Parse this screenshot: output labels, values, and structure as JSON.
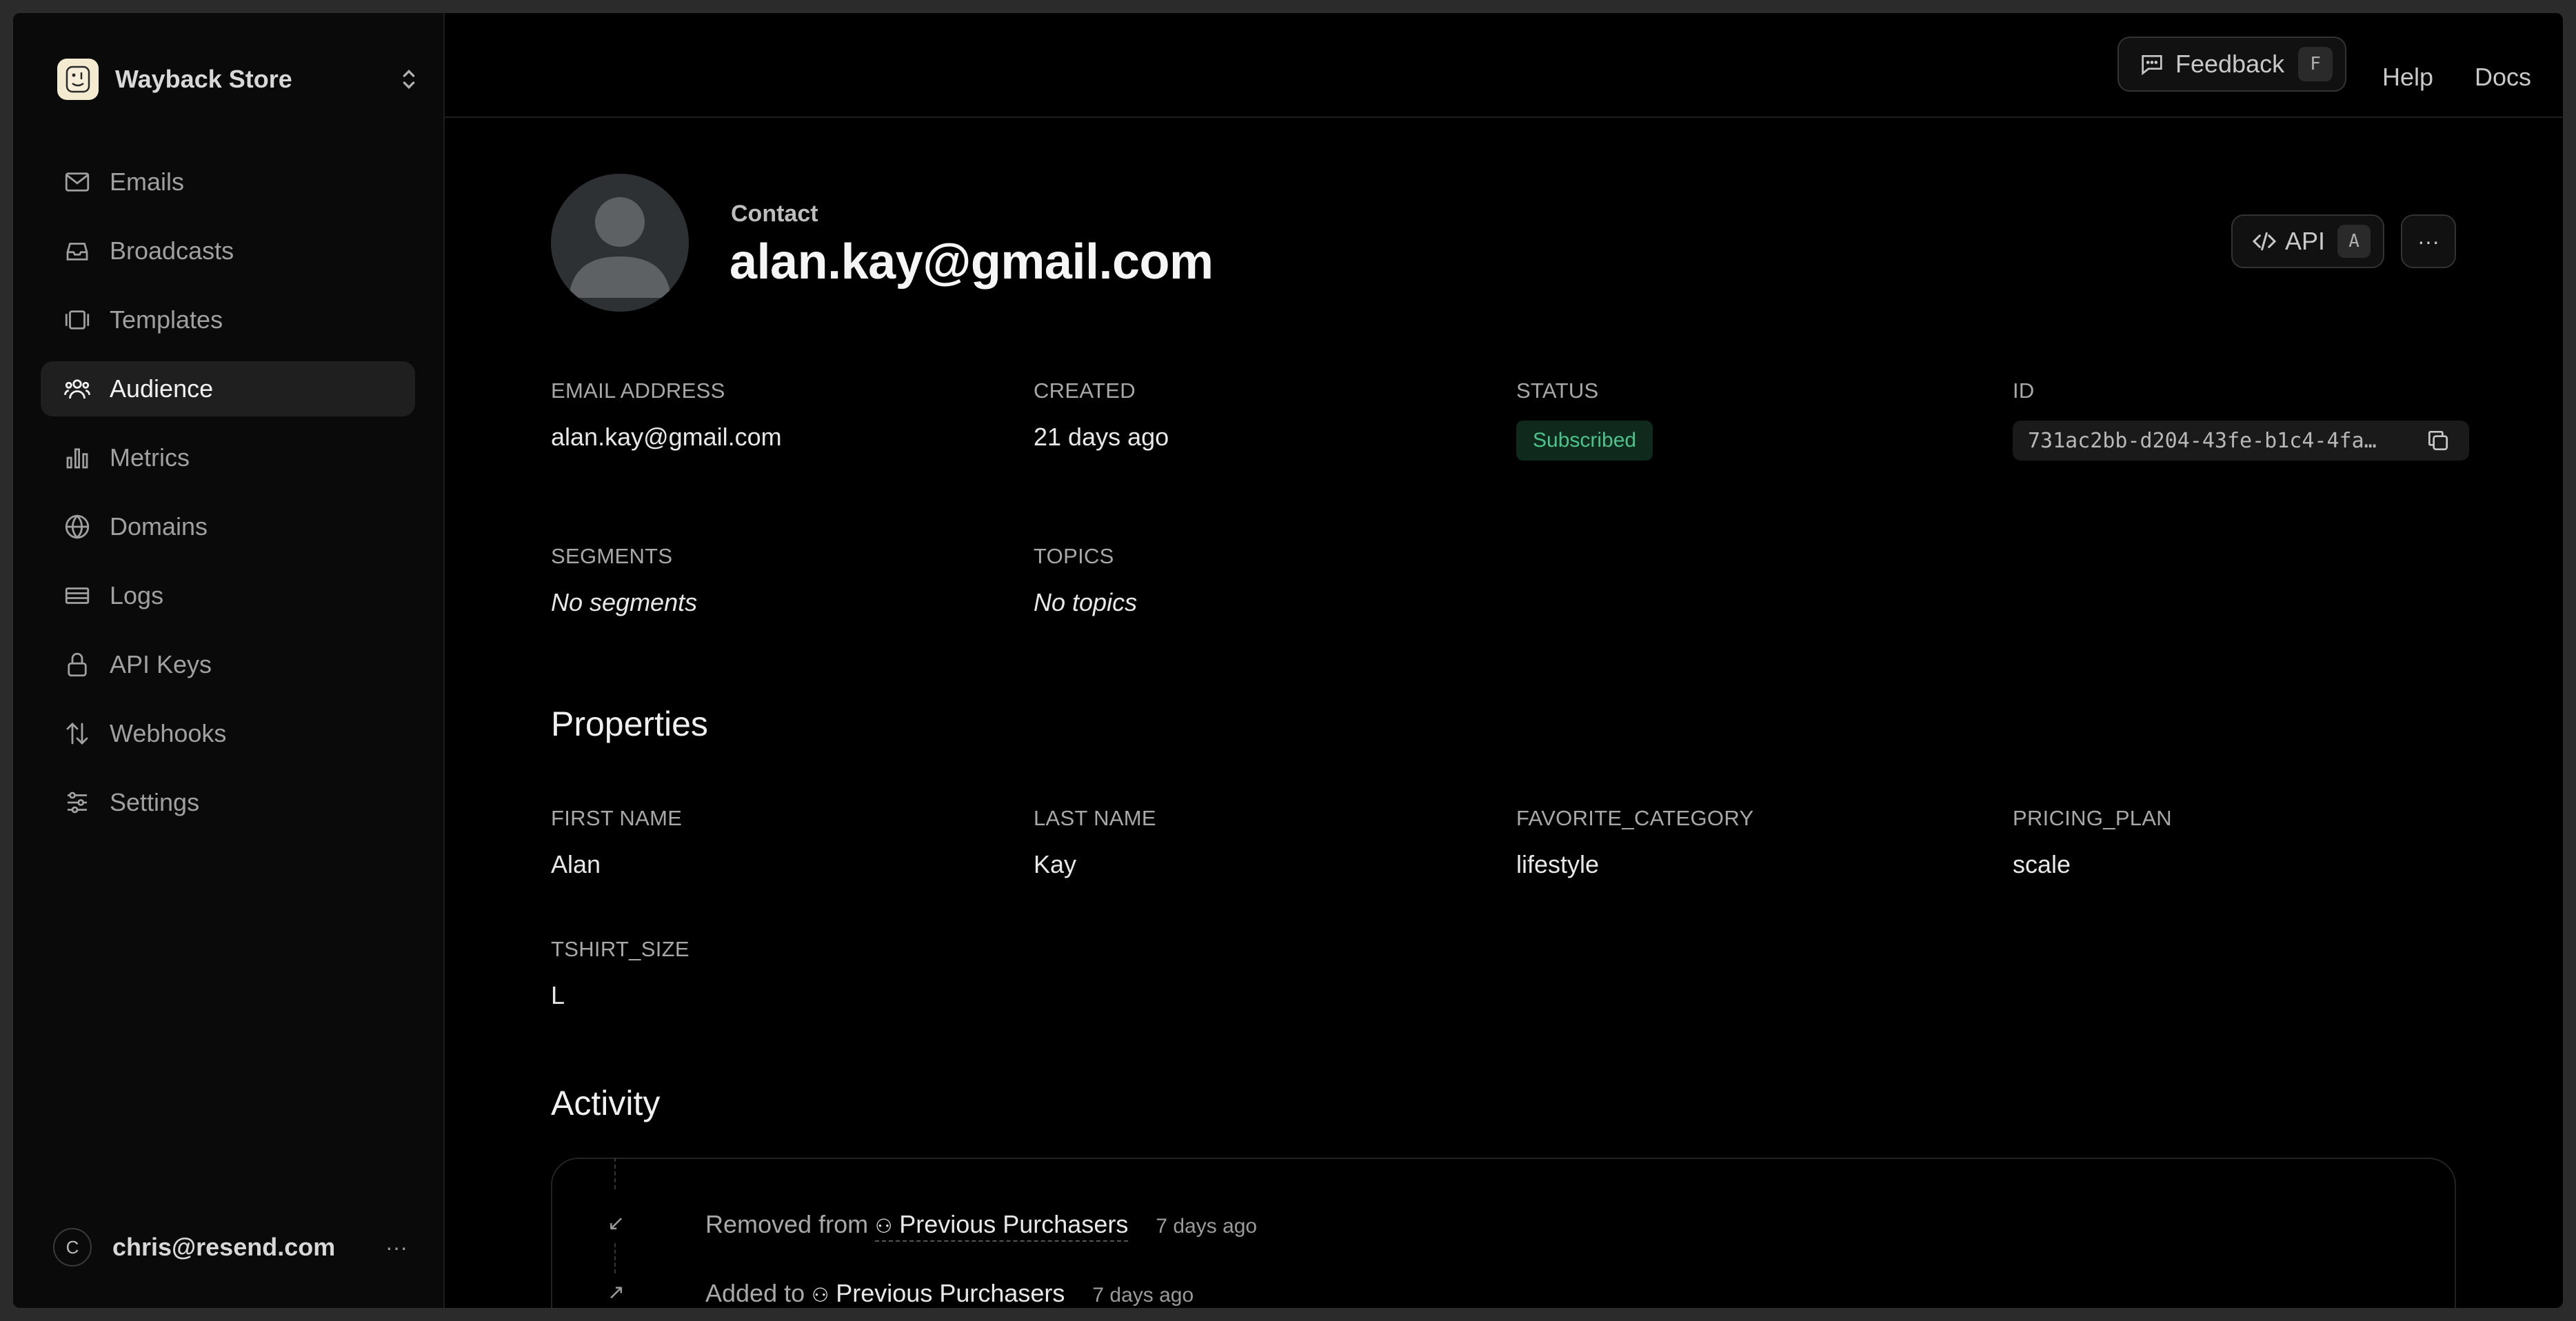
{
  "sidebar": {
    "team_name": "Wayback Store",
    "items": [
      {
        "label": "Emails",
        "icon": "mail-icon",
        "active": false
      },
      {
        "label": "Broadcasts",
        "icon": "inbox-icon",
        "active": false
      },
      {
        "label": "Templates",
        "icon": "templates-icon",
        "active": false
      },
      {
        "label": "Audience",
        "icon": "users-icon",
        "active": true
      },
      {
        "label": "Metrics",
        "icon": "bar-chart-icon",
        "active": false
      },
      {
        "label": "Domains",
        "icon": "globe-icon",
        "active": false
      },
      {
        "label": "Logs",
        "icon": "logs-icon",
        "active": false
      },
      {
        "label": "API Keys",
        "icon": "lock-icon",
        "active": false
      },
      {
        "label": "Webhooks",
        "icon": "arrows-updown-icon",
        "active": false
      },
      {
        "label": "Settings",
        "icon": "sliders-icon",
        "active": false
      }
    ],
    "user": {
      "initial": "C",
      "email": "chris@resend.com",
      "more": "···"
    }
  },
  "topbar": {
    "feedback_label": "Feedback",
    "feedback_key": "F",
    "help_label": "Help",
    "docs_label": "Docs"
  },
  "contact": {
    "label": "Contact",
    "title": "alan.kay@gmail.com",
    "api_label": "API",
    "api_key": "A",
    "more": "···"
  },
  "fields": {
    "email_label": "Email Address",
    "email_value": "alan.kay@gmail.com",
    "created_label": "Created",
    "created_value": "21 days ago",
    "status_label": "Status",
    "status_value": "Subscribed",
    "id_label": "ID",
    "id_value": "731ac2bb-d204-43fe-b1c4-4fa…",
    "segments_label": "Segments",
    "segments_value": "No segments",
    "topics_label": "Topics",
    "topics_value": "No topics"
  },
  "properties": {
    "title": "Properties",
    "first_name_label": "First Name",
    "first_name_value": "Alan",
    "last_name_label": "Last Name",
    "last_name_value": "Kay",
    "favorite_category_label": "Favorite_Category",
    "favorite_category_value": "lifestyle",
    "pricing_plan_label": "Pricing_Plan",
    "pricing_plan_value": "scale",
    "tshirt_size_label": "Tshirt_Size",
    "tshirt_size_value": "L"
  },
  "activity": {
    "title": "Activity",
    "items": [
      {
        "icon": "↙",
        "action": "Removed from",
        "segment": "Previous Purchasers",
        "time": "7 days ago"
      },
      {
        "icon": "↗",
        "action": "Added to",
        "segment": "Previous Purchasers",
        "time": "7 days ago"
      }
    ]
  },
  "colors": {
    "background": "#000000",
    "sidebar": "#0a0a0a",
    "status_green": "#4cc38a",
    "status_bg": "#0f2a1d"
  }
}
